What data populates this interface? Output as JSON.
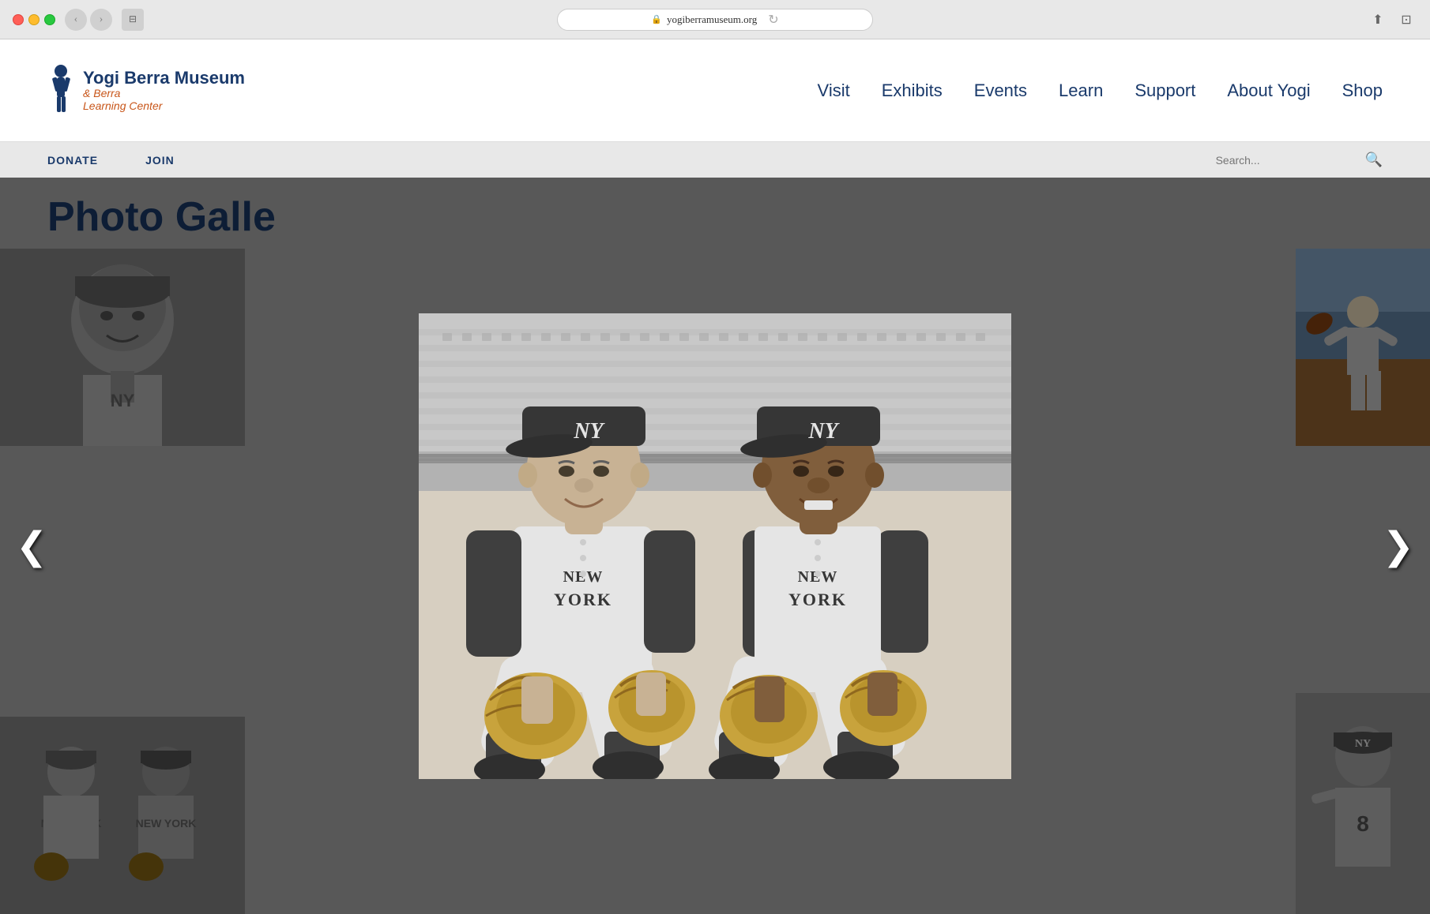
{
  "browser": {
    "url": "yogiberramuseum.org",
    "reload_icon": "↻",
    "share_icon": "⬆",
    "fullscreen_icon": "⊡"
  },
  "header": {
    "logo": {
      "line1": "Yogi Berra Museum",
      "line2": "& Berra",
      "line3": "Learning Center"
    },
    "nav": {
      "items": [
        {
          "label": "Visit",
          "id": "visit"
        },
        {
          "label": "Exhibits",
          "id": "exhibits"
        },
        {
          "label": "Events",
          "id": "events"
        },
        {
          "label": "Learn",
          "id": "learn"
        },
        {
          "label": "Support",
          "id": "support"
        },
        {
          "label": "About Yogi",
          "id": "about-yogi"
        },
        {
          "label": "Shop",
          "id": "shop"
        }
      ]
    },
    "secondary_nav": {
      "items": [
        {
          "label": "DONATE",
          "id": "donate"
        },
        {
          "label": "JOIN",
          "id": "join"
        }
      ],
      "search_placeholder": "Search..."
    }
  },
  "main": {
    "page_title": "Photo Galle",
    "lightbox": {
      "close_label": "✕",
      "nav_left": "❮",
      "nav_right": "❯",
      "image_alt": "Two New York Yankees catchers in uniform crouching with baseball gloves"
    }
  }
}
